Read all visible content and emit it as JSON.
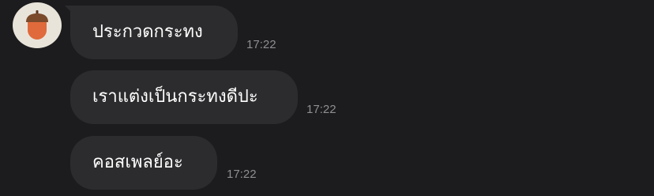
{
  "contact": {
    "avatar_icon": "acorn-icon"
  },
  "messages": [
    {
      "text": "ประกวดกระทง",
      "time": "17:22"
    },
    {
      "text": "เราแต่งเป็นกระทงดีปะ",
      "time": "17:22"
    },
    {
      "text": "คอสเพลย์อะ",
      "time": "17:22"
    }
  ],
  "colors": {
    "background": "#1c1c1e",
    "bubble": "#2c2c2e",
    "text": "#ffffff",
    "timestamp": "#8e8e93",
    "avatar_bg": "#e9e4da",
    "acorn_cap": "#7a4a2a",
    "acorn_body": "#e06a3b"
  }
}
